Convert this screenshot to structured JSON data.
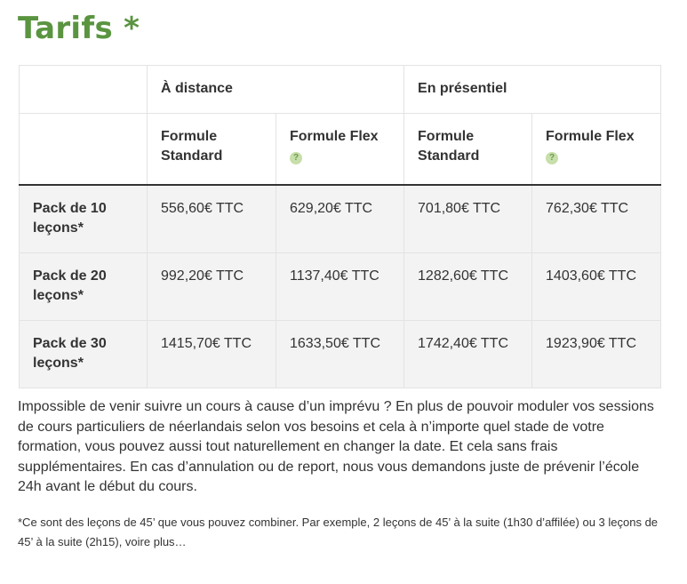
{
  "title": "Tarifs *",
  "table": {
    "groups": [
      "",
      "À distance",
      "En présentiel"
    ],
    "formulas": [
      "",
      "Formule Standard",
      "Formule Flex",
      "Formule Standard",
      "Formule Flex"
    ],
    "help_glyph": "?",
    "rows": [
      {
        "label": "Pack de 10 leçons*",
        "prices": [
          "556,60€ TTC",
          "629,20€ TTC",
          "701,80€ TTC",
          "762,30€ TTC"
        ]
      },
      {
        "label": "Pack de 20 leçons*",
        "prices": [
          "992,20€ TTC",
          "1137,40€ TTC",
          "1282,60€ TTC",
          "1403,60€ TTC"
        ]
      },
      {
        "label": "Pack de 30 leçons*",
        "prices": [
          "1415,70€ TTC",
          "1633,50€ TTC",
          "1742,40€ TTC",
          "1923,90€ TTC"
        ]
      }
    ]
  },
  "intro_text": "Impossible de venir suivre un cours à cause d’un imprévu ? En plus de pouvoir moduler vos sessions de cours particuliers de néerlandais selon vos besoins et cela à n’importe quel stade de votre formation, vous pouvez aussi tout naturellement en changer la date. Et cela sans frais supplémentaires. En cas d’annulation ou de report, nous vous demandons juste de prévenir l’école 24h avant le début du cours.",
  "footnote": "*Ce sont des leçons de 45’ que vous pouvez combiner. Par exemple, 2 leçons de 45’ à la suite (1h30 d’affilée) ou 3 leçons de 45’ à la suite (2h15), voire plus…",
  "colors": {
    "title": "#5a9440",
    "help_icon_bg": "#c7dfaa",
    "row_bg": "#f3f3f3",
    "border": "#e3e3e3"
  }
}
